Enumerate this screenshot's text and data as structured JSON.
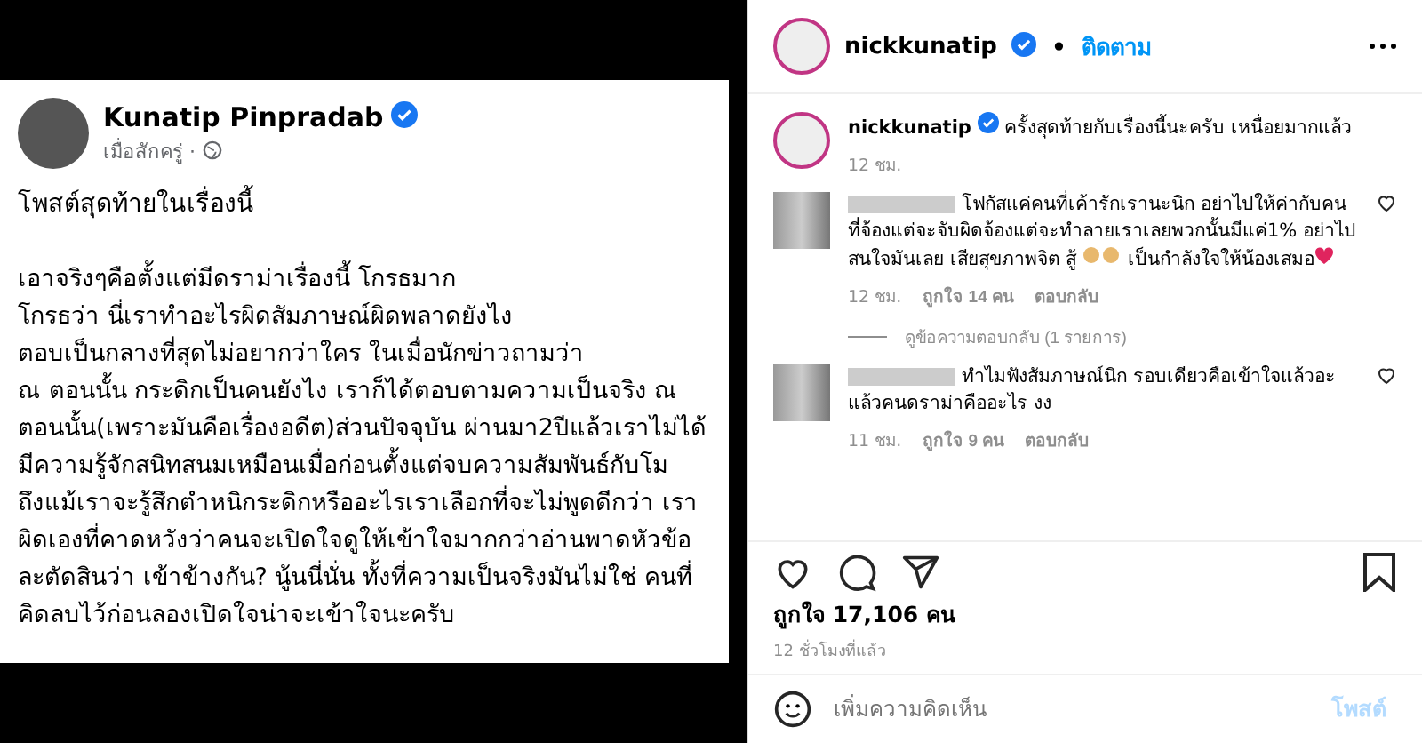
{
  "fb_post": {
    "author": "Kunatip Pinpradab",
    "verified": true,
    "time": "เมื่อสักครู่ ·",
    "title": "โพสต์สุดท้ายในเรื่องนี้",
    "paragraphs": [
      "เอาจริงๆคือตั้งแต่มีดราม่าเรื่องนี้ โกรธมาก",
      "โกรธว่า นี่เราทำอะไรผิดสัมภาษณ์ผิดพลาดยังไง",
      "ตอบเป็นกลางที่สุดไม่อยากว่าใคร ในเมื่อนักข่าวถามว่า",
      "ณ ตอนนั้น กระดิกเป็นคนยังไง  เราก็ได้ตอบตามความเป็นจริง ณ",
      "ตอนนั้น(เพราะมันคือเรื่องอดีต)ส่วนปัจจุบัน ผ่านมา2ปีแล้วเราไม่ได้",
      "มีความรู้จักสนิทสนมเหมือนเมื่อก่อนตั้งแต่จบความสัมพันธ์กับโม",
      "ถึงแม้เราจะรู้สึกตำหนิกระดิกหรืออะไรเราเลือกที่จะไม่พูดดีกว่า เรา",
      "ผิดเองที่คาดหวังว่าคนจะเปิดใจดูให้เข้าใจมากกว่าอ่านพาดหัวข้อ",
      "ละตัดสินว่า เข้าข้างกัน? นู้นนี่นั่น ทั้งที่ความเป็นจริงมันไม่ใช่ คนที่",
      "คิดลบไว้ก่อนลองเปิดใจน่าจะเข้าใจนะครับ"
    ]
  },
  "header": {
    "username": "nickkunatip",
    "verified": true,
    "separator": "•",
    "follow": "ติดตาม"
  },
  "caption": {
    "username": "nickkunatip",
    "verified": true,
    "text": "ครั้งสุดท้ายกับเรื่องนี้นะครับ เหนื่อยมากแล้ว",
    "time": "12 ชม."
  },
  "comments": [
    {
      "parts": [
        "โฟกัสแค่คนที่เค้ารักเรานะนิก อย่าไปให้ค่ากับคนที่จ้องแต่จะจับผิดจ้องแต่จะทำลายเราเลยพวกนั้นมีแค่1% อย่าไปสนใจมันเลย เสียสุขภาพจิต สู้",
        "เป็นกำลังใจให้น้องเสมอ"
      ],
      "time": "12 ชม.",
      "likes": "ถูกใจ 14 คน",
      "reply": "ตอบกลับ",
      "view_replies": "ดูข้อความตอบกลับ (1 รายการ)"
    },
    {
      "parts": [
        "ทำไมฟังสัมภาษณ์นิก รอบเดียวคือเข้าใจแล้วอะ แล้วคนดราม่าคืออะไร งง"
      ],
      "time": "11 ชม.",
      "likes": "ถูกใจ 9 คน",
      "reply": "ตอบกลับ"
    }
  ],
  "likes": "ถูกใจ 17,106 คน",
  "posted": "12 ชั่วโมงที่แล้ว",
  "comment_box": {
    "placeholder": "เพิ่มความคิดเห็น",
    "post": "โพสต์"
  }
}
